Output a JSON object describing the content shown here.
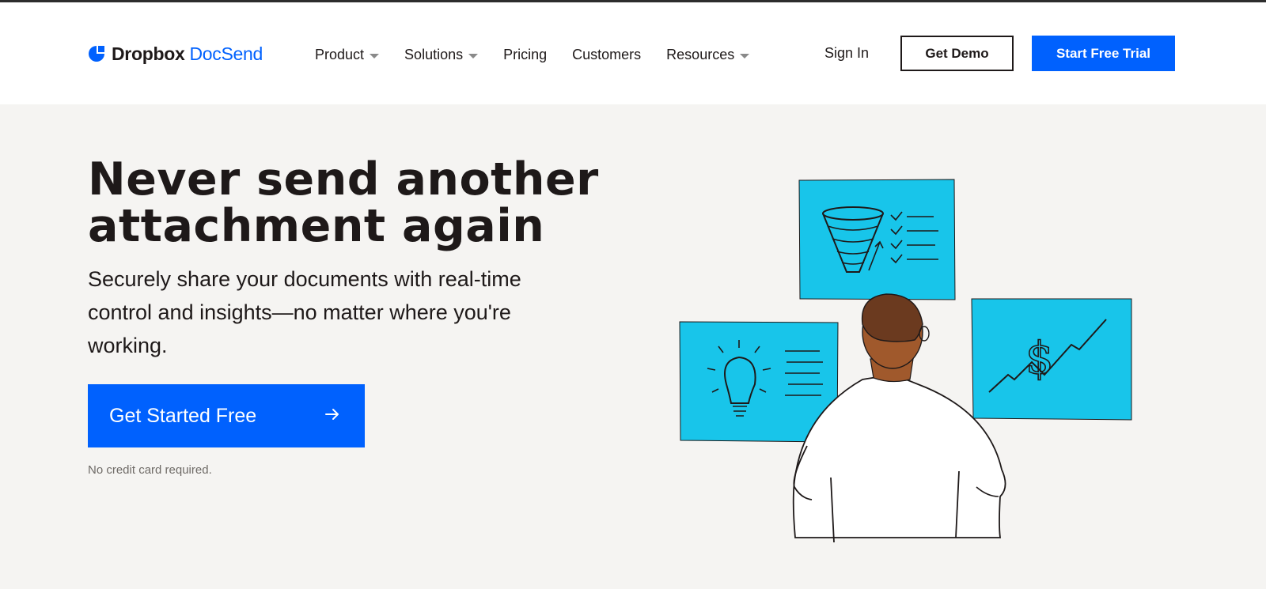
{
  "header": {
    "brand": "Dropbox",
    "product": "DocSend",
    "nav": [
      {
        "label": "Product",
        "has_dropdown": true
      },
      {
        "label": "Solutions",
        "has_dropdown": true
      },
      {
        "label": "Pricing",
        "has_dropdown": false
      },
      {
        "label": "Customers",
        "has_dropdown": false
      },
      {
        "label": "Resources",
        "has_dropdown": true
      }
    ],
    "sign_in": "Sign In",
    "demo_button": "Get Demo",
    "trial_button": "Start Free Trial"
  },
  "hero": {
    "headline_line1": "Never send another",
    "headline_line2": "attachment again",
    "subhead": "Securely share your documents with real-time control and insights—no matter where you're working.",
    "cta_label": "Get Started Free",
    "note": "No credit card required."
  },
  "icons": {
    "logo": "dropbox-logo-icon",
    "dropdown": "chevron-down-icon",
    "cta_arrow": "arrow-right-icon",
    "illustration": "person-looking-at-boards-illustration"
  },
  "colors": {
    "accent": "#0061fe",
    "hero_bg": "#f5f4f2",
    "card": "#18c5ea",
    "text": "#1e1919"
  }
}
